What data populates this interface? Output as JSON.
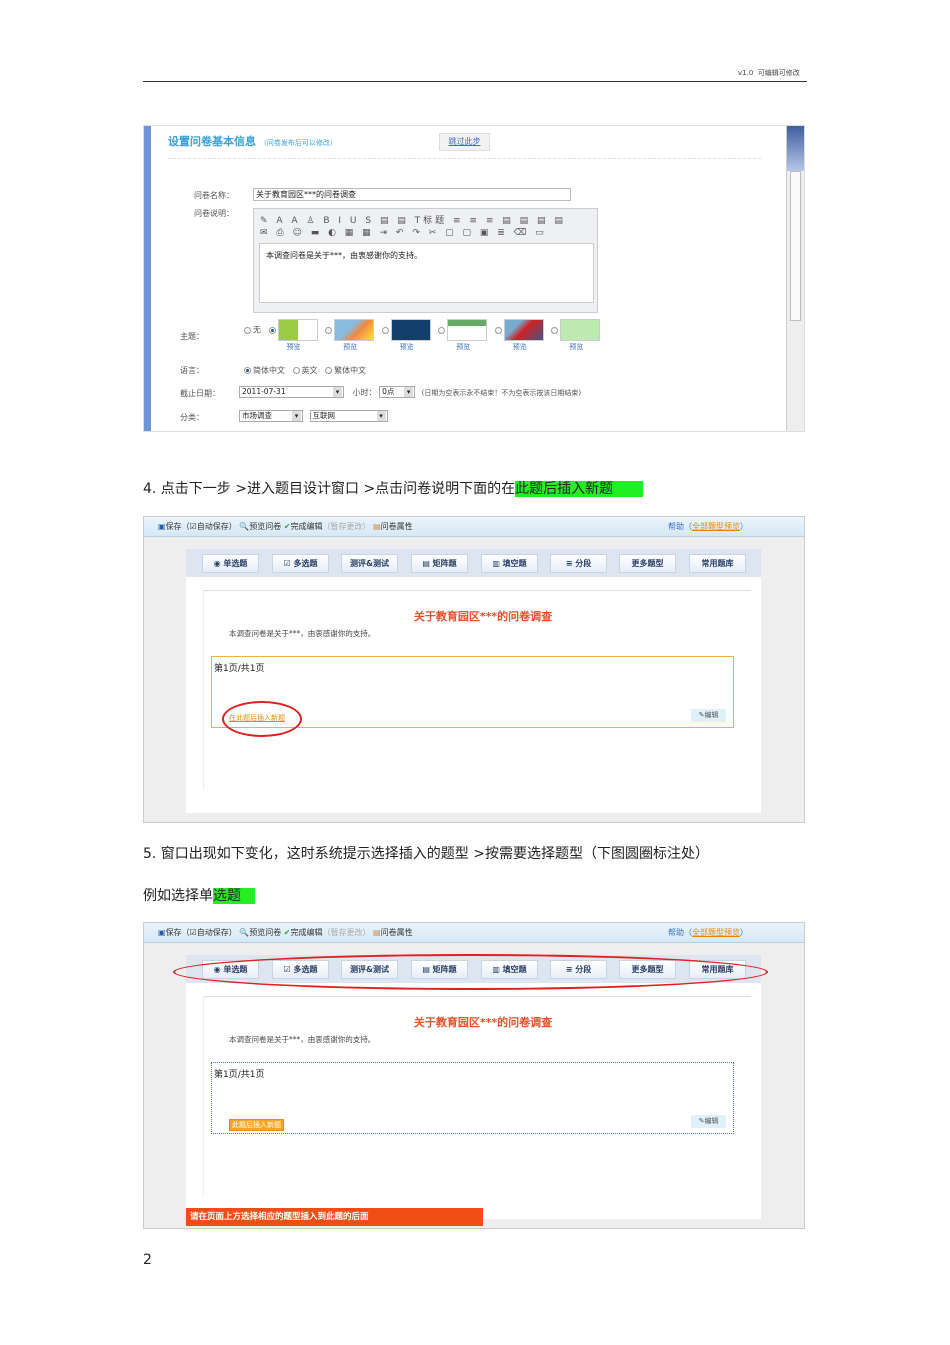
{
  "header": {
    "version": "v1.0",
    "note": "可编辑可修改"
  },
  "shot1": {
    "title": "设置问卷基本信息",
    "title_note": "（问卷发布后可以修改）",
    "skip_button": "跳过此步",
    "name_label": "问卷名称：",
    "name_value": "关于教育园区***的问卷调查",
    "desc_label": "问卷说明：",
    "toolbar_row1": "✎ A A ♙ B I U S ▤ ▤ T标题 ≡ ≡ ≡ ▤ ▤ ▤ ▤",
    "toolbar_row2": "✉ ⎙ ☺ ▬ ◐ ▦ ▦ ⇥ ↶ ↷ ✂ ▢ ▢ ▣ ≣ ⌫ ▭",
    "desc_value": "本调查问卷是关于***，由衷感谢你的支持。",
    "theme_label": "主题：",
    "theme_none": "无",
    "preview": "预览",
    "lang_label": "语言：",
    "lang_options": [
      "简体中文",
      "英文",
      "繁体中文"
    ],
    "date_label": "截止日期：",
    "date_value": "2011-07-31",
    "hour_label": "小时：",
    "hour_value": "0点",
    "date_hint": "(日期为空表示永不结束！不为空表示按该日期结束)",
    "cat_label": "分类：",
    "cat1": "市场调查",
    "cat2": "互联网"
  },
  "step4": {
    "prefix": "4. 点击下一步   >进入题目设计窗口    >点击问卷说明下面的在",
    "highlight": "此题后插入新题"
  },
  "step5": {
    "line1": "5. 窗口出现如下变化，这时系统提示选择插入的题型          >按需要选择题型（下图圆圈标注处）",
    "line2_prefix": "例如选择单",
    "line2_highlight": "选题"
  },
  "editor": {
    "save": "保存",
    "autosave": "（☑自动保存）",
    "preview": "预览问卷",
    "finish": "完成编辑",
    "finish_note": "（暂存更改）",
    "props": "问卷属性",
    "help": "帮助",
    "help_link": "全部题型预览",
    "qtypes": [
      "◉ 单选题",
      "☑ 多选题",
      "测评&测试",
      "▤ 矩阵题",
      "▥ 填空题",
      "≡ 分段",
      "更多题型",
      "常用题库"
    ],
    "title": "关于教育园区***的问卷调查",
    "desc": "本调查问卷是关于***，由衷感谢你的支持。",
    "page": "第1页/共1页",
    "insert": "在此题后插入新题",
    "insert2": "此题后插入新题",
    "edit": "编辑",
    "hint": "请在页面上方选择相应的题型插入到此题的后面"
  },
  "page_number": "2"
}
